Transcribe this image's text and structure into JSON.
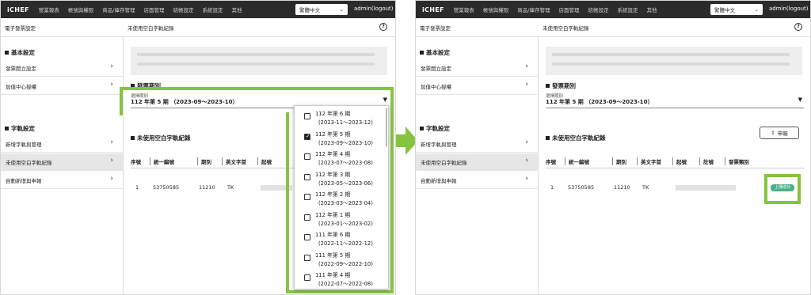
{
  "header": {
    "brand": "iCHEF",
    "nav": [
      "營業報表",
      "帳號與權限",
      "商品/庫存管理",
      "店面管理",
      "結帳設定",
      "系統設定",
      "其他"
    ],
    "language": "繁體中文",
    "admin": "admin(logout)"
  },
  "subbar": {
    "left_title": "電子發票設定",
    "right_title": "未使用空白字軌紀錄",
    "help": "?"
  },
  "sidebar": {
    "section1": "基本設定",
    "items1": [
      "發票開立設定",
      "加值中心授權"
    ],
    "section2": "字軌設定",
    "items2": [
      "新增字軌與管理",
      "未使用空白字軌紀錄",
      "自動新增與申報"
    ]
  },
  "content": {
    "period_title": "發票期別",
    "period_label": "選擇期別",
    "period_value": "112 年第 5 期 （2023-09～2023-10）",
    "unused_title": "未使用空白字軌紀錄",
    "report_button": "申報",
    "columns_left": [
      "序號",
      "統一編號",
      "期別",
      "英文字首",
      "起號"
    ],
    "columns_right": [
      "序號",
      "統一編號",
      "期別",
      "英文字首",
      "起號",
      "訖號",
      "發票類別"
    ],
    "row": [
      "1",
      "53750585",
      "11210",
      "TK"
    ],
    "status_badge": "上傳成功"
  },
  "dropdown": {
    "options": [
      {
        "title": "112 年第 6 期",
        "range": "(2023-11～2023-12)",
        "checked": false
      },
      {
        "title": "112 年第 5 期",
        "range": "(2023-09～2023-10)",
        "checked": true
      },
      {
        "title": "112 年第 4 期",
        "range": "(2023-07～2023-08)",
        "checked": false
      },
      {
        "title": "112 年第 3 期",
        "range": "(2023-05～2023-06)",
        "checked": false
      },
      {
        "title": "112 年第 2 期",
        "range": "(2023-03～2023-04)",
        "checked": false
      },
      {
        "title": "112 年第 1 期",
        "range": "(2023-01～2023-02)",
        "checked": false
      },
      {
        "title": "111 年第 6 期",
        "range": "(2022-11～2022-12)",
        "checked": false
      },
      {
        "title": "111 年第 5 期",
        "range": "(2022-09～2022-10)",
        "checked": false
      },
      {
        "title": "111 年第 4 期",
        "range": "(2022-07～2022-08)",
        "checked": false
      }
    ]
  },
  "colors": {
    "topbar": "#2b2b2b",
    "highlight": "#86c440",
    "badge": "#4caf8a",
    "active_item": "#e6e6e6"
  },
  "icons": [
    "chevron-right-icon",
    "caret-down-icon",
    "help-circle-icon",
    "upload-icon",
    "checkbox-icon",
    "arrow-right-icon"
  ]
}
